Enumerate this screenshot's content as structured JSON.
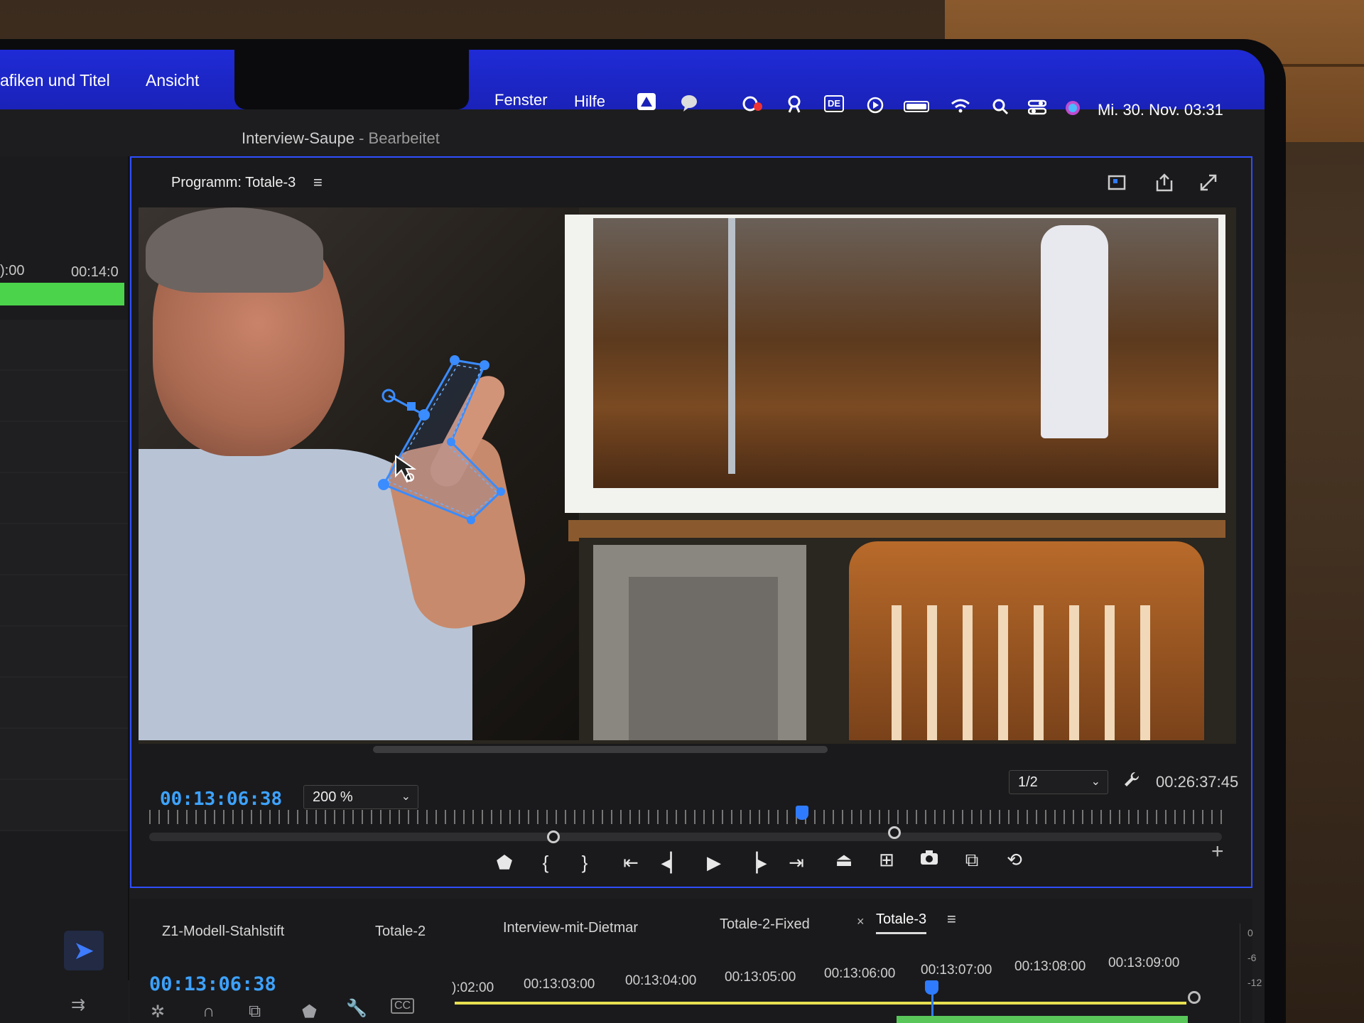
{
  "menubar": {
    "items_left": [
      "afiken und Titel",
      "Ansicht"
    ],
    "items_right": [
      "Fenster",
      "Hilfe"
    ],
    "language": "DE",
    "clock": "Mi. 30. Nov. 03:31",
    "colors": {
      "menubar_bg": "#1f2bd6"
    }
  },
  "document": {
    "name": "Interview-Saupe",
    "status": "- Bearbeitet"
  },
  "left_panel": {
    "times": [
      "):00",
      "00:14:0"
    ]
  },
  "program": {
    "title": "Programm: Totale-3",
    "current_timecode": "00:13:06:38",
    "zoom": "200 %",
    "resolution": "1/2",
    "duration": "00:26:37:45"
  },
  "timeline": {
    "tabs": [
      "Z1-Modell-Stahlstift",
      "Totale-2",
      "Interview-mit-Dietmar",
      "Totale-2-Fixed",
      "Totale-3"
    ],
    "active_tab": "Totale-3",
    "timecode": "00:13:06:38",
    "ruler": [
      "):02:00",
      "00:13:03:00",
      "00:13:04:00",
      "00:13:05:00",
      "00:13:06:00",
      "00:13:07:00",
      "00:13:08:00",
      "00:13:09:00"
    ],
    "meter_labels": [
      "0",
      "-6",
      "-12"
    ]
  },
  "icons": {
    "menu": "hamburger-icon",
    "export": "share-icon",
    "fullscreen": "expand-icon",
    "settings": "wrench-icon"
  }
}
